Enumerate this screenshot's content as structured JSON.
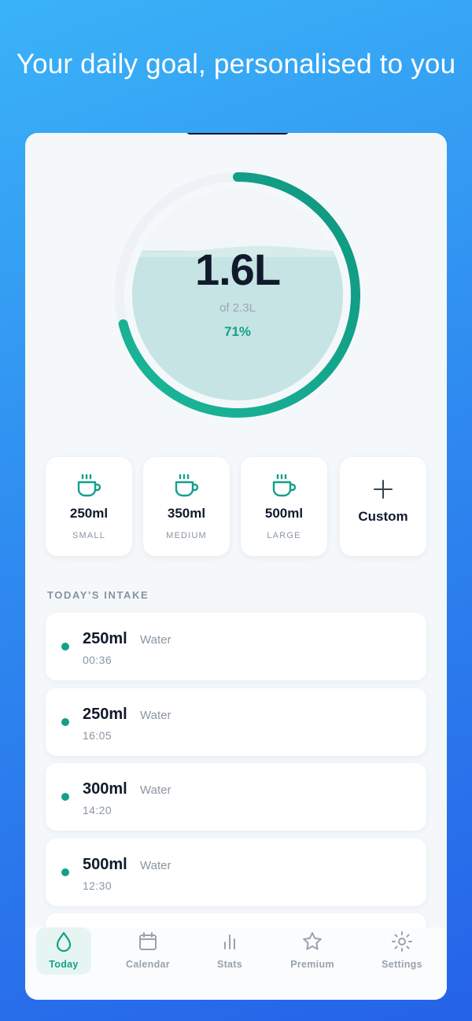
{
  "headline": "Your daily goal, personalised to you",
  "progress": {
    "amount": "1.6L",
    "goal": "of 2.3L",
    "percent": "71%",
    "fraction": 0.71,
    "ring_color": "#14a08a",
    "water_color": "#c6e4e3"
  },
  "quick_add": [
    {
      "volume": "250ml",
      "size": "SMALL",
      "icon": "cup-icon"
    },
    {
      "volume": "350ml",
      "size": "MEDIUM",
      "icon": "cup-icon"
    },
    {
      "volume": "500ml",
      "size": "LARGE",
      "icon": "cup-icon"
    },
    {
      "volume": "Custom",
      "icon": "plus-icon"
    }
  ],
  "intake": {
    "title": "TODAY'S INTAKE",
    "entries": [
      {
        "volume": "250ml",
        "kind": "Water",
        "time": "00:36"
      },
      {
        "volume": "250ml",
        "kind": "Water",
        "time": "16:05"
      },
      {
        "volume": "300ml",
        "kind": "Water",
        "time": "14:20"
      },
      {
        "volume": "500ml",
        "kind": "Water",
        "time": "12:30"
      }
    ]
  },
  "tabs": [
    {
      "label": "Today",
      "icon": "water-drop-icon",
      "active": true
    },
    {
      "label": "Calendar",
      "icon": "calendar-icon",
      "active": false
    },
    {
      "label": "Stats",
      "icon": "bar-chart-icon",
      "active": false
    },
    {
      "label": "Premium",
      "icon": "star-icon",
      "active": false
    },
    {
      "label": "Settings",
      "icon": "gear-icon",
      "active": false
    }
  ],
  "colors": {
    "accent": "#14a08a",
    "background_top": "#3ab3f7",
    "background_bottom": "#2563e8"
  }
}
